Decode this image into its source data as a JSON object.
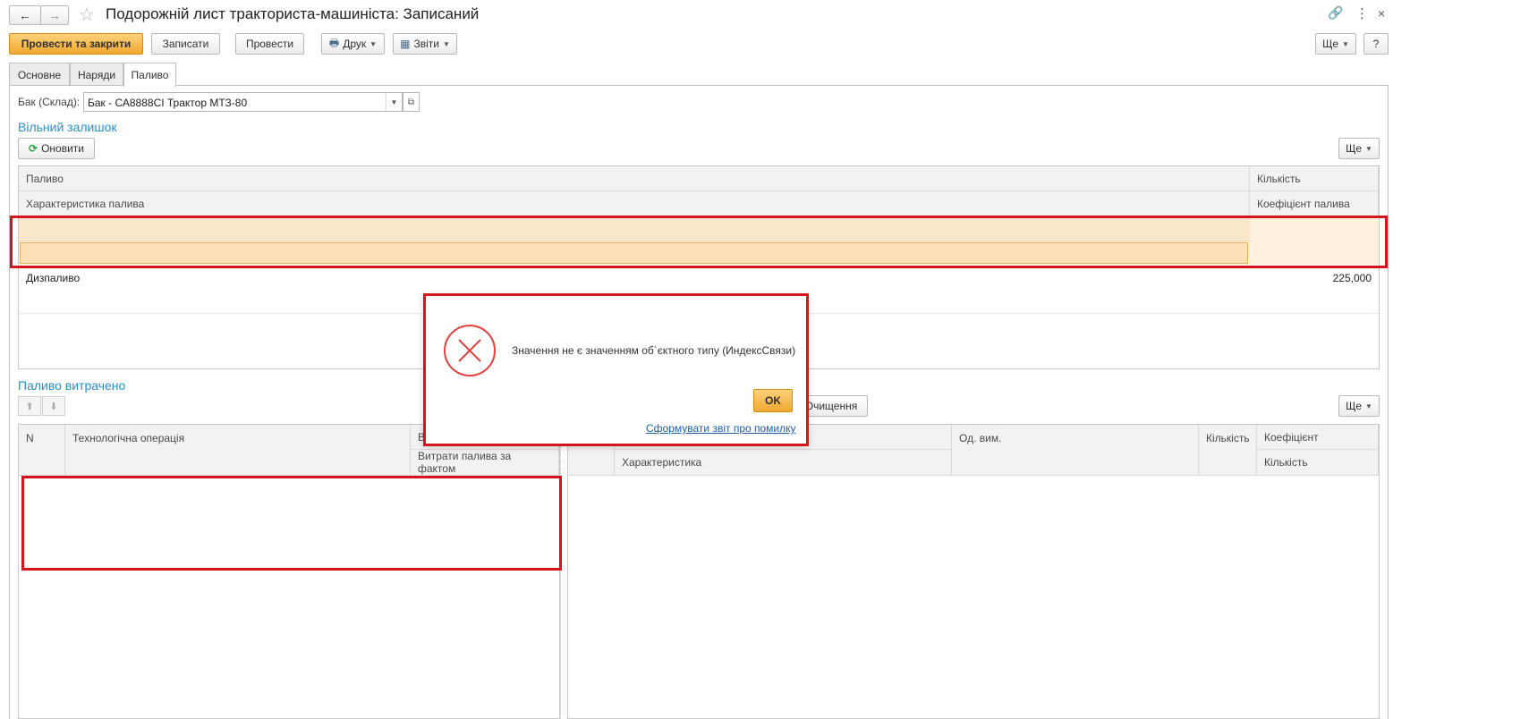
{
  "window": {
    "title": "Подорожній лист тракториста-машиніста: Записаний",
    "back_icon": "arrow-left-icon",
    "forward_icon": "arrow-right-icon",
    "star_icon": "star-icon",
    "link_icon": "link-icon",
    "menu_icon": "more-vertical-icon",
    "close_icon": "close-icon"
  },
  "toolbar": {
    "post_close_label": "Провести та закрити",
    "save_label": "Записати",
    "post_label": "Провести",
    "print_label": "Друк",
    "reports_label": "Звіти",
    "more_label": "Ще",
    "help_label": "?"
  },
  "tabs": [
    {
      "label": "Основне"
    },
    {
      "label": "Наряди"
    },
    {
      "label": "Паливо"
    }
  ],
  "tank": {
    "label": "Бак (Склад):",
    "value": "Бак - СА8888СІ Трактор МТЗ-80"
  },
  "free_balance": {
    "title": "Вільний залишок",
    "refresh_label": "Оновити",
    "more_label": "Ще",
    "columns": {
      "fuel": "Паливо",
      "quantity": "Кількість",
      "fuel_characteristic": "Характеристика палива",
      "fuel_coefficient": "Коефіцієнт палива"
    },
    "rows": [
      {
        "fuel": "Дизпаливо",
        "quantity": "225,000"
      }
    ]
  },
  "fuel_spent": {
    "title": "Паливо витрачено",
    "clear_label": "Очищення",
    "more_label": "Ще",
    "left_columns": {
      "n": "N",
      "operation": "Технологічна операція",
      "top_right": "В",
      "actual_consumption": "Витрати палива за фактом"
    },
    "right_columns": {
      "characteristic": "Характеристика",
      "unit": "Од. вим.",
      "quantity": "Кількість",
      "coefficient": "Коефіцієнт",
      "quantity2": "Кількість"
    }
  },
  "dialog": {
    "icon": "error-circle-x-icon",
    "message": "Значення не є значенням об`єктного типу (ИндексСвязи)",
    "ok_label": "OK",
    "report_link": "Сформувати звіт про помилку"
  },
  "colors": {
    "accent_blue": "#2a8fc7",
    "primary_orange": "#f0a830",
    "selected_row": "#fbe2bd",
    "highlight_red": "#d4151b"
  }
}
